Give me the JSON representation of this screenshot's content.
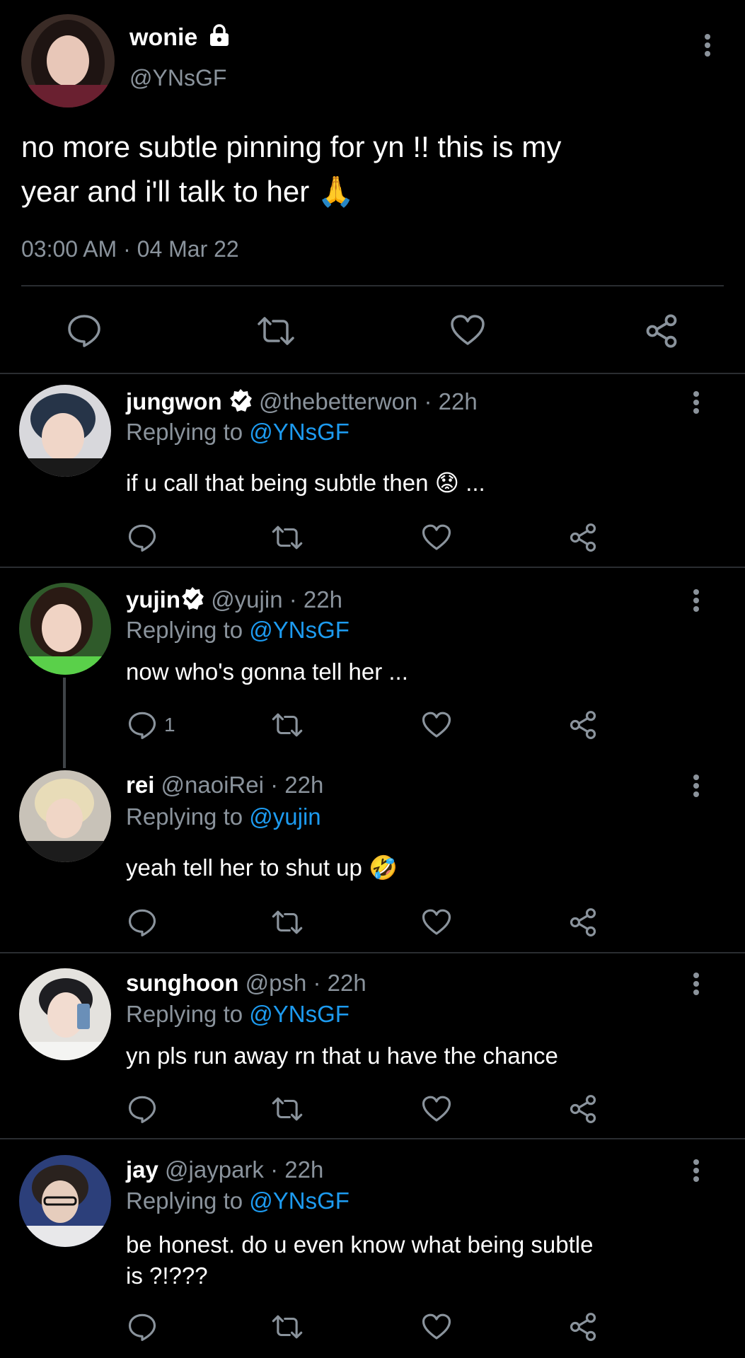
{
  "main": {
    "name": "wonie",
    "handle": "@YNsGF",
    "text_line1": "no more subtle pinning for yn !! this is my",
    "text_line2": "year and i'll talk to her",
    "emoji": "🙏",
    "timestamp": "03:00 AM · 04 Mar 22"
  },
  "replies": [
    {
      "name": "jungwon",
      "handle": "@thebetterwon · 22h",
      "replying_prefix": "Replying to",
      "replying_to": "@YNsGF",
      "text": "if u call that being subtle then",
      "emoji": "😟",
      "suffix": "...",
      "reply_count": ""
    },
    {
      "name": "yujin",
      "handle": "@yujin · 22h",
      "replying_prefix": "Replying to",
      "replying_to": "@YNsGF",
      "text": "now who's gonna tell her ...",
      "reply_count": "1"
    },
    {
      "name": "rei",
      "handle": "@naoiRei · 22h",
      "replying_prefix": "Replying to",
      "replying_to": "@yujin",
      "text": "yeah tell her to shut up",
      "emoji": "🤣"
    },
    {
      "name": "sunghoon",
      "handle": "@psh · 22h",
      "replying_prefix": "Replying to",
      "replying_to": "@YNsGF",
      "text": "yn pls run away rn that u have the chance"
    },
    {
      "name": "jay",
      "handle": "@jaypark · 22h",
      "replying_prefix": "Replying to",
      "replying_to": "@YNsGF",
      "text_line1": "be honest. do u even know what being subtle",
      "text_line2": "is ?!???"
    }
  ],
  "colors": {
    "background": "#000000",
    "muted": "#8a939c",
    "link": "#1d9bf0",
    "divider": "#2a2d31"
  },
  "icons": [
    "lock-icon",
    "verified-badge-icon",
    "more-icon",
    "reply-icon",
    "retweet-icon",
    "like-icon",
    "share-icon"
  ]
}
